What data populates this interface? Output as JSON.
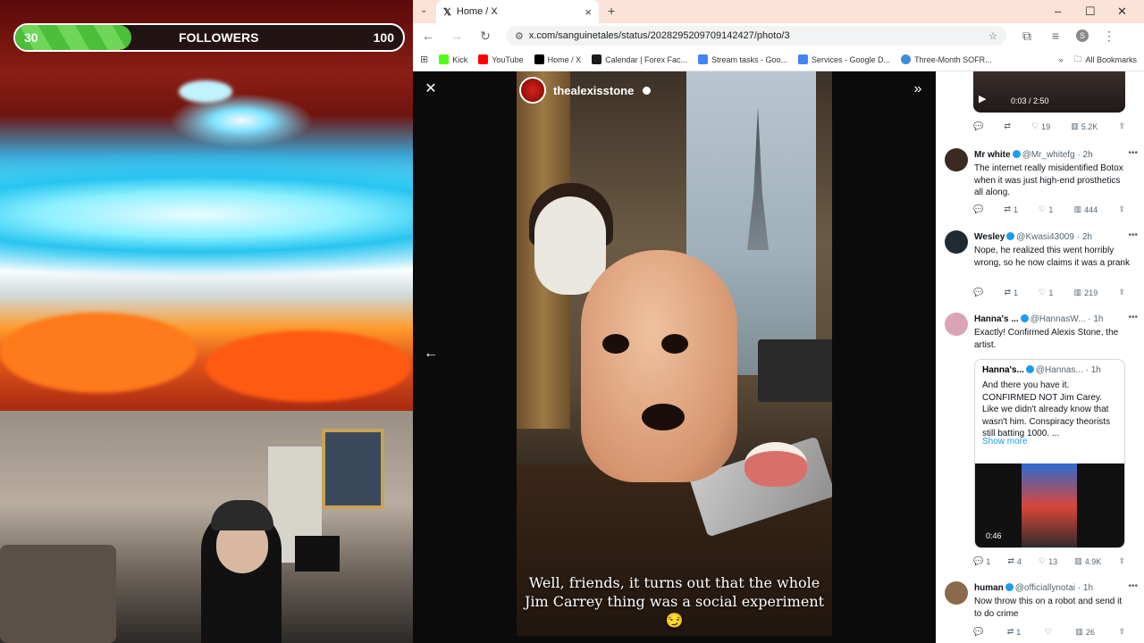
{
  "overlay": {
    "followers_label": "FOLLOWERS",
    "followers_current": "30",
    "followers_goal": "100",
    "followers_progress": 0.3,
    "bar_color": "#4bbf3a"
  },
  "browser": {
    "tab_title": "Home / X",
    "url": "x.com/sanguinetales/status/2028295209709142427/photo/3",
    "bookmarks": [
      {
        "label": "Kick",
        "color": "#53fc18"
      },
      {
        "label": "YouTube",
        "color": "#ff0000"
      },
      {
        "label": "Home / X",
        "color": "#000000"
      },
      {
        "label": "Calendar | Forex Fac...",
        "color": "#1a1a1a"
      },
      {
        "label": "Stream tasks - Goo...",
        "color": "#4285f4"
      },
      {
        "label": "Services - Google D...",
        "color": "#4285f4"
      },
      {
        "label": "Three-Month SOFR...",
        "color": "#3c8dde"
      }
    ],
    "all_bookmarks": "All Bookmarks",
    "profile_initial": "S"
  },
  "media": {
    "author": "thealexisstone",
    "caption": "Well, friends, it turns out that the whole Jim Carrey thing was a social experiment😏"
  },
  "replies": {
    "video_time": "0:03 / 2:50",
    "top_actions": {
      "replies": "",
      "reposts": "",
      "likes": "19",
      "views": "5.2K"
    },
    "items": [
      {
        "name": "Mr white",
        "handle": "@Mr_whitefg",
        "time": "2h",
        "text": "The internet really misidentified Botox when it was just high-end prosthetics all along.",
        "reposts": "1",
        "likes": "1",
        "views": "444",
        "avatar_color": "#3a2a22"
      },
      {
        "name": "Wesley",
        "handle": "@Kwasi43009",
        "time": "2h",
        "text": "Nope, he realized this went horribly wrong, so he now claims it was a prank",
        "reposts": "1",
        "likes": "1",
        "views": "219",
        "avatar_color": "#1f2a33"
      },
      {
        "name": "Hanna's ...",
        "handle": "@HannasW...",
        "time": "1h",
        "text": "Exactly! Confirmed Alexis Stone, the artist.",
        "replies": "1",
        "reposts": "4",
        "likes": "13",
        "views": "4.9K",
        "avatar_color": "#d9a3b8",
        "quote": {
          "name": "Hanna's...",
          "handle": "@Hannas...",
          "time": "1h",
          "text": "And there you have it. CONFIRMED NOT Jim Carey. Like we didn't already know that wasn't him. Conspiracy theorists still batting 1000. ...",
          "show_more": "Show more",
          "duration": "0:46"
        }
      },
      {
        "name": "human",
        "handle": "@officiallynotai",
        "time": "1h",
        "text": "Now throw this on a robot and send it to do crime",
        "reposts": "1",
        "likes": "",
        "views": "26",
        "avatar_color": "#8a6a4a"
      }
    ]
  }
}
